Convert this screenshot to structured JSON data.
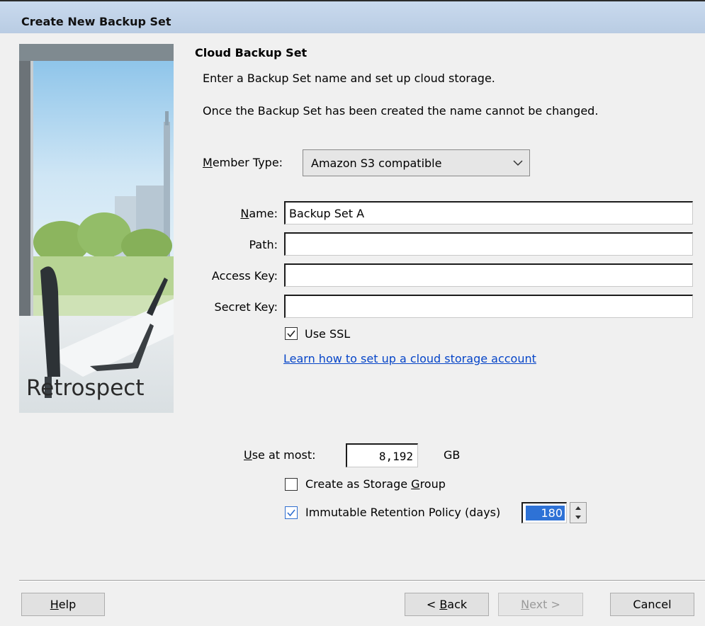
{
  "window": {
    "title": "Create New Backup Set"
  },
  "sidebar": {
    "logo_text": "Retrospect"
  },
  "section": {
    "heading": "Cloud Backup Set",
    "intro": "Enter a Backup Set name and set up cloud storage.",
    "note": "Once the Backup Set has been created the name cannot be changed."
  },
  "member_type": {
    "label_mnemonic": "M",
    "label_rest": "ember Type:",
    "selected": "Amazon S3 compatible"
  },
  "fields": {
    "name": {
      "label_mnemonic": "N",
      "label_rest": "ame:",
      "value": "Backup Set A"
    },
    "path": {
      "label": "Path:",
      "value": ""
    },
    "access_key": {
      "label": "Access Key:",
      "value": ""
    },
    "secret_key": {
      "label": "Secret Key:",
      "value": ""
    }
  },
  "use_ssl": {
    "label": "Use SSL",
    "checked": true
  },
  "help_link": "Learn how to set up a cloud storage account",
  "capacity": {
    "label_mnemonic": "U",
    "label_rest": "se at most:",
    "value": "8,192",
    "unit": "GB"
  },
  "storage_group": {
    "label_pre": "Create as Storage ",
    "label_mnemonic": "G",
    "label_post": "roup",
    "checked": false
  },
  "retention": {
    "label": "Immutable Retention Policy (days)",
    "checked": true,
    "value": "180"
  },
  "buttons": {
    "help": {
      "mnemonic": "H",
      "rest": "elp"
    },
    "back": {
      "pre": "< ",
      "mnemonic": "B",
      "rest": "ack"
    },
    "next": {
      "mnemonic": "N",
      "rest": "ext >",
      "disabled": true
    },
    "cancel": "Cancel"
  },
  "colors": {
    "titlebar": "#c3d5ea",
    "accent": "#2e72d6",
    "link": "#0645c8"
  }
}
